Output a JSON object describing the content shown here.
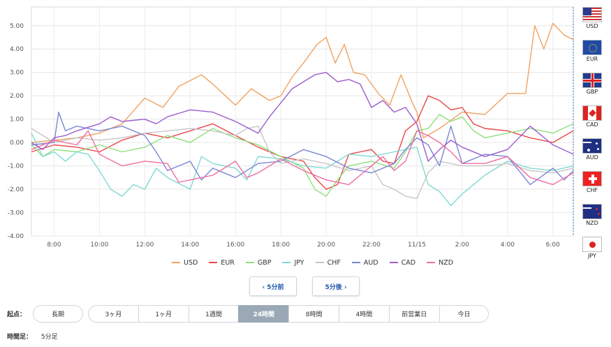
{
  "chart_data": {
    "type": "line",
    "title": "",
    "xlabel": "",
    "ylabel": "",
    "ylim": [
      -4,
      5.8
    ],
    "yticks": [
      "5.00",
      "4.00",
      "3.00",
      "2.00",
      "1.00",
      "0.00",
      "-1.00",
      "-2.00",
      "-3.00",
      "-4.00"
    ],
    "ytick_values": [
      5,
      4,
      3,
      2,
      1,
      0,
      -1,
      -2,
      -3,
      -4
    ],
    "xrange_hours": [
      7,
      30.9
    ],
    "xticks": [
      "8:00",
      "10:00",
      "12:00",
      "14:00",
      "16:00",
      "18:00",
      "20:00",
      "22:00",
      "11/15",
      "2:00",
      "4:00",
      "6:00"
    ],
    "xtick_values": [
      8,
      10,
      12,
      14,
      16,
      18,
      20,
      22,
      24,
      26,
      28,
      30
    ],
    "grid": true,
    "legend_position": "bottom",
    "series": [
      {
        "name": "USD",
        "color": "#f0a261",
        "points": [
          [
            7,
            0
          ],
          [
            8,
            0.1
          ],
          [
            9,
            0.2
          ],
          [
            10,
            0.4
          ],
          [
            11,
            0.8
          ],
          [
            12,
            1.9
          ],
          [
            12.8,
            1.5
          ],
          [
            13.5,
            2.4
          ],
          [
            14.5,
            2.9
          ],
          [
            15,
            2.5
          ],
          [
            16,
            1.6
          ],
          [
            16.7,
            2.3
          ],
          [
            17.5,
            1.8
          ],
          [
            18,
            2.0
          ],
          [
            18.5,
            2.8
          ],
          [
            19,
            3.4
          ],
          [
            19.6,
            4.2
          ],
          [
            20,
            4.5
          ],
          [
            20.4,
            3.4
          ],
          [
            20.8,
            4.2
          ],
          [
            21.2,
            3.0
          ],
          [
            21.7,
            2.9
          ],
          [
            22.3,
            2.1
          ],
          [
            22.8,
            1.6
          ],
          [
            23.3,
            2.9
          ],
          [
            23.8,
            1.7
          ],
          [
            24,
            1.3
          ],
          [
            24.3,
            0.2
          ],
          [
            25,
            0.6
          ],
          [
            26,
            1.3
          ],
          [
            27,
            1.2
          ],
          [
            28,
            2.1
          ],
          [
            28.8,
            2.1
          ],
          [
            29.2,
            5.0
          ],
          [
            29.6,
            4.0
          ],
          [
            30,
            5.1
          ],
          [
            30.5,
            4.6
          ],
          [
            30.9,
            4.4
          ]
        ]
      },
      {
        "name": "EUR",
        "color": "#e8474b",
        "points": [
          [
            7,
            -0.4
          ],
          [
            8,
            -0.1
          ],
          [
            9,
            -0.2
          ],
          [
            10,
            -0.4
          ],
          [
            11,
            0.1
          ],
          [
            12,
            0.4
          ],
          [
            13,
            0.2
          ],
          [
            14,
            0.5
          ],
          [
            15,
            0.8
          ],
          [
            16,
            0.3
          ],
          [
            17,
            -0.2
          ],
          [
            18,
            -0.6
          ],
          [
            19,
            -0.8
          ],
          [
            19.5,
            -1.5
          ],
          [
            20,
            -2.0
          ],
          [
            20.5,
            -1.8
          ],
          [
            21,
            -0.5
          ],
          [
            21.5,
            -0.4
          ],
          [
            22,
            -0.3
          ],
          [
            22.5,
            -0.8
          ],
          [
            23,
            -0.9
          ],
          [
            23.5,
            0.5
          ],
          [
            24,
            0.9
          ],
          [
            24.5,
            2.0
          ],
          [
            25,
            1.8
          ],
          [
            25.5,
            1.4
          ],
          [
            26,
            1.5
          ],
          [
            26.5,
            0.8
          ],
          [
            27,
            0.6
          ],
          [
            28,
            0.5
          ],
          [
            29,
            0.2
          ],
          [
            30,
            0.0
          ],
          [
            30.9,
            0.5
          ]
        ]
      },
      {
        "name": "GBP",
        "color": "#8ee07a",
        "points": [
          [
            7,
            -0.1
          ],
          [
            7.5,
            -0.6
          ],
          [
            8,
            -0.3
          ],
          [
            9,
            -0.4
          ],
          [
            10,
            -0.1
          ],
          [
            11,
            -0.4
          ],
          [
            12,
            -0.2
          ],
          [
            13,
            0.3
          ],
          [
            14,
            0.0
          ],
          [
            15,
            0.6
          ],
          [
            16,
            0.2
          ],
          [
            17,
            -0.1
          ],
          [
            18,
            -0.6
          ],
          [
            19,
            -1.1
          ],
          [
            19.5,
            -2.0
          ],
          [
            20,
            -2.3
          ],
          [
            20.5,
            -1.6
          ],
          [
            21,
            -1.0
          ],
          [
            22,
            -0.8
          ],
          [
            23,
            -1.1
          ],
          [
            23.5,
            -0.4
          ],
          [
            24,
            0.5
          ],
          [
            24.5,
            0.6
          ],
          [
            25,
            1.2
          ],
          [
            25.5,
            0.9
          ],
          [
            26,
            1.1
          ],
          [
            26.5,
            0.5
          ],
          [
            27,
            0.2
          ],
          [
            28,
            0.4
          ],
          [
            29,
            0.6
          ],
          [
            30,
            0.4
          ],
          [
            30.9,
            0.8
          ]
        ]
      },
      {
        "name": "JPY",
        "color": "#7fdad2",
        "points": [
          [
            7,
            0.4
          ],
          [
            7.5,
            -0.6
          ],
          [
            8,
            -0.4
          ],
          [
            8.5,
            -0.8
          ],
          [
            9,
            -0.4
          ],
          [
            9.5,
            -0.5
          ],
          [
            10,
            -1.2
          ],
          [
            10.5,
            -2.0
          ],
          [
            11,
            -2.3
          ],
          [
            11.5,
            -1.8
          ],
          [
            12,
            -2.0
          ],
          [
            12.5,
            -1.1
          ],
          [
            13,
            -1.5
          ],
          [
            14,
            -2.0
          ],
          [
            14.5,
            -0.6
          ],
          [
            15,
            -0.9
          ],
          [
            16,
            -1.1
          ],
          [
            16.5,
            -1.6
          ],
          [
            17,
            -0.6
          ],
          [
            18,
            -0.7
          ],
          [
            19,
            -1.0
          ],
          [
            20,
            -1.1
          ],
          [
            21,
            -0.5
          ],
          [
            22,
            -0.6
          ],
          [
            23,
            -0.4
          ],
          [
            24,
            -0.2
          ],
          [
            24.5,
            -1.8
          ],
          [
            25,
            -2.1
          ],
          [
            25.5,
            -2.7
          ],
          [
            26,
            -2.2
          ],
          [
            27,
            -1.4
          ],
          [
            28,
            -0.8
          ],
          [
            29,
            -1.1
          ],
          [
            30,
            -1.2
          ],
          [
            30.9,
            -1.0
          ]
        ]
      },
      {
        "name": "CHF",
        "color": "#c6c6c6",
        "points": [
          [
            7,
            0.6
          ],
          [
            8,
            0.0
          ],
          [
            9,
            0.2
          ],
          [
            10,
            0.1
          ],
          [
            11,
            0.2
          ],
          [
            12,
            0.4
          ],
          [
            13,
            0.5
          ],
          [
            14,
            0.6
          ],
          [
            15,
            0.5
          ],
          [
            16,
            0.3
          ],
          [
            16.5,
            0.6
          ],
          [
            17,
            0.7
          ],
          [
            17.5,
            -0.4
          ],
          [
            18,
            -0.9
          ],
          [
            19,
            -0.7
          ],
          [
            20,
            -0.9
          ],
          [
            21,
            -1.2
          ],
          [
            22,
            -1.0
          ],
          [
            22.5,
            -1.8
          ],
          [
            23,
            -2.0
          ],
          [
            23.5,
            -2.3
          ],
          [
            24,
            -2.4
          ],
          [
            24.5,
            -1.3
          ],
          [
            25,
            -0.8
          ],
          [
            26,
            -1.0
          ],
          [
            27,
            -1.0
          ],
          [
            28,
            -0.9
          ],
          [
            29,
            -1.2
          ],
          [
            30,
            -1.3
          ],
          [
            30.9,
            -1.1
          ]
        ]
      },
      {
        "name": "AUD",
        "color": "#7a86d4",
        "points": [
          [
            7,
            -0.1
          ],
          [
            8,
            0.0
          ],
          [
            8.2,
            1.3
          ],
          [
            8.5,
            0.5
          ],
          [
            9,
            0.7
          ],
          [
            10,
            0.5
          ],
          [
            11,
            0.7
          ],
          [
            12,
            0.3
          ],
          [
            12.5,
            -0.4
          ],
          [
            13,
            -1.2
          ],
          [
            14,
            -0.8
          ],
          [
            14.5,
            -1.6
          ],
          [
            15,
            -1.1
          ],
          [
            16,
            -1.5
          ],
          [
            17,
            -0.9
          ],
          [
            18,
            -0.8
          ],
          [
            19,
            -0.3
          ],
          [
            20,
            -0.6
          ],
          [
            21,
            -1.1
          ],
          [
            22,
            -1.3
          ],
          [
            23,
            -0.9
          ],
          [
            23.5,
            -0.3
          ],
          [
            24,
            0.2
          ],
          [
            24.5,
            -0.1
          ],
          [
            25,
            -1.0
          ],
          [
            25.5,
            0.7
          ],
          [
            26,
            -0.9
          ],
          [
            27,
            -0.5
          ],
          [
            28,
            -0.6
          ],
          [
            29,
            -1.8
          ],
          [
            30,
            -1.1
          ],
          [
            30.5,
            -1.6
          ],
          [
            30.9,
            -1.2
          ]
        ]
      },
      {
        "name": "CAD",
        "color": "#9c5ccc",
        "points": [
          [
            7,
            0.0
          ],
          [
            7.5,
            -0.3
          ],
          [
            8,
            0.2
          ],
          [
            8.5,
            0.3
          ],
          [
            9,
            0.5
          ],
          [
            10,
            0.8
          ],
          [
            10.5,
            1.1
          ],
          [
            11,
            0.9
          ],
          [
            12,
            1.0
          ],
          [
            12.5,
            0.8
          ],
          [
            13,
            1.1
          ],
          [
            14,
            1.4
          ],
          [
            15,
            1.3
          ],
          [
            16,
            0.9
          ],
          [
            17,
            0.4
          ],
          [
            17.5,
            1.1
          ],
          [
            18,
            1.7
          ],
          [
            18.5,
            2.3
          ],
          [
            19,
            2.6
          ],
          [
            19.5,
            2.9
          ],
          [
            20,
            3.0
          ],
          [
            20.5,
            2.6
          ],
          [
            21,
            2.7
          ],
          [
            21.5,
            2.5
          ],
          [
            22,
            1.5
          ],
          [
            22.5,
            1.8
          ],
          [
            23,
            1.3
          ],
          [
            23.5,
            1.5
          ],
          [
            24,
            0.8
          ],
          [
            24.5,
            -0.8
          ],
          [
            25,
            -0.3
          ],
          [
            25.5,
            0.1
          ],
          [
            26,
            -0.2
          ],
          [
            27,
            -0.6
          ],
          [
            28,
            -0.3
          ],
          [
            29,
            0.7
          ],
          [
            30,
            -0.1
          ],
          [
            30.9,
            -0.5
          ]
        ]
      },
      {
        "name": "NZD",
        "color": "#ee6ea3",
        "points": [
          [
            7,
            -0.3
          ],
          [
            8,
            0.1
          ],
          [
            9,
            -0.1
          ],
          [
            9.5,
            0.5
          ],
          [
            10,
            -0.5
          ],
          [
            11,
            -1.0
          ],
          [
            12,
            -0.8
          ],
          [
            13,
            -0.9
          ],
          [
            13.5,
            -1.7
          ],
          [
            14,
            -1.6
          ],
          [
            15,
            -1.4
          ],
          [
            16,
            -0.8
          ],
          [
            16.5,
            -1.5
          ],
          [
            17,
            -1.3
          ],
          [
            18,
            -0.7
          ],
          [
            19,
            -1.2
          ],
          [
            20,
            -1.6
          ],
          [
            21,
            -1.8
          ],
          [
            22,
            -1.0
          ],
          [
            22.5,
            -0.6
          ],
          [
            23,
            -1.2
          ],
          [
            23.5,
            -0.8
          ],
          [
            24,
            0.5
          ],
          [
            24.5,
            0.3
          ],
          [
            25,
            0.0
          ],
          [
            25.5,
            -0.4
          ],
          [
            26,
            -0.9
          ],
          [
            27,
            -0.9
          ],
          [
            28,
            -0.6
          ],
          [
            29,
            -1.5
          ],
          [
            30,
            -1.8
          ],
          [
            30.9,
            -1.3
          ]
        ]
      }
    ]
  },
  "flags": [
    {
      "code": "USD"
    },
    {
      "code": "EUR"
    },
    {
      "code": "GBP"
    },
    {
      "code": "CAD"
    },
    {
      "code": "AUD"
    },
    {
      "code": "CHF"
    },
    {
      "code": "NZD"
    },
    {
      "code": "JPY"
    }
  ],
  "nav": {
    "prev_label": "‹ 5分前",
    "next_label": "5分後 ›"
  },
  "start": {
    "label": "起点：",
    "long_label": "長期",
    "options": [
      "3ヶ月",
      "1ヶ月",
      "1週間",
      "24時間",
      "8時間",
      "4時間",
      "前営業日",
      "今日"
    ],
    "active": "24時間"
  },
  "timeframe": {
    "label": "時間足：",
    "value": "5分足"
  }
}
